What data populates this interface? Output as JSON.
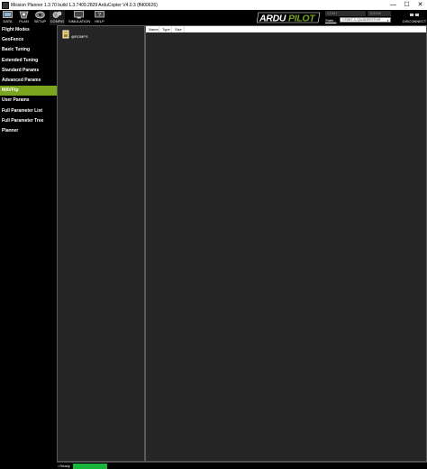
{
  "window": {
    "title": "Mission Planner 1.3.70 build 1.3.7409.2829 ArduCopter V4.0.3 (ffd00626)",
    "minimize": "—",
    "maximize": "☐",
    "close": "✕"
  },
  "toolbar": {
    "items": [
      {
        "label": "DATA",
        "icon": "data-icon"
      },
      {
        "label": "PLAN",
        "icon": "plan-icon"
      },
      {
        "label": "SETUP",
        "icon": "setup-icon"
      },
      {
        "label": "CONFIG",
        "icon": "config-icon"
      },
      {
        "label": "SIMULATION",
        "icon": "simulation-icon"
      },
      {
        "label": "HELP",
        "icon": "help-icon"
      }
    ],
    "active_item": "CONFIG"
  },
  "connection": {
    "port": "COM7",
    "baud": "115200",
    "stats_label": "Stats...",
    "link": "COM7-1-QUADROTOR",
    "disconnect_label": "DISCONNECT"
  },
  "sidebar": {
    "items": [
      {
        "label": "Flight Modes"
      },
      {
        "label": "GeoFence"
      },
      {
        "label": "Basic Tuning"
      },
      {
        "label": "Extended Tuning"
      },
      {
        "label": "Standard Params"
      },
      {
        "label": "Advanced Params"
      },
      {
        "label": "MAVFtp"
      },
      {
        "label": "User Params"
      },
      {
        "label": "Full Parameter List"
      },
      {
        "label": "Full Parameter Tree"
      },
      {
        "label": "Planner"
      }
    ],
    "active_item": "MAVFtp"
  },
  "tree": {
    "root_label": "@ROMFS"
  },
  "file_list": {
    "columns": [
      "Name",
      "Type",
      "Size"
    ]
  },
  "status": {
    "text": "/ Ready",
    "progress": 1.0,
    "progress_color": "#19b43a"
  },
  "colors": {
    "accent": "#7ba51f",
    "background": "#000000",
    "panel": "#262626"
  }
}
